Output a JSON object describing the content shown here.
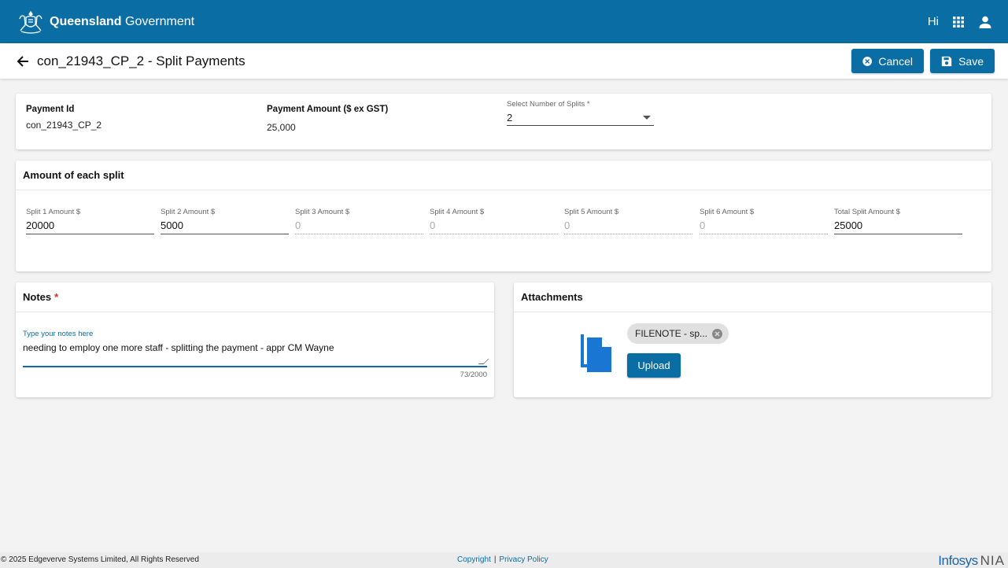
{
  "header": {
    "brand_bold": "Queensland",
    "brand_rest": " Government",
    "greeting": "Hi"
  },
  "subheader": {
    "title": "con_21943_CP_2 - Split Payments",
    "cancel_label": "Cancel",
    "save_label": "Save"
  },
  "payment": {
    "id_label": "Payment Id",
    "id_value": "con_21943_CP_2",
    "amount_label": "Payment Amount ($ ex GST)",
    "amount_value": "25,000",
    "splits_label": "Select Number of Splits *",
    "splits_value": "2"
  },
  "splits": {
    "title": "Amount of each split",
    "items": [
      {
        "label": "Split 1 Amount $",
        "value": "20000"
      },
      {
        "label": "Split 2 Amount $",
        "value": "5000"
      },
      {
        "label": "Split 3 Amount $",
        "value": "0"
      },
      {
        "label": "Split 4 Amount $",
        "value": "0"
      },
      {
        "label": "Split 5 Amount $",
        "value": "0"
      },
      {
        "label": "Split 6 Amount $",
        "value": "0"
      },
      {
        "label": "Total Split Amount $",
        "value": "25000"
      }
    ]
  },
  "notes": {
    "title": "Notes",
    "required_mark": "*",
    "placeholder": "Type your notes here",
    "value": "needing to employ one more staff - splitting the payment - appr CM Wayne",
    "counter": "73/2000"
  },
  "attachments": {
    "title": "Attachments",
    "file_chip": "FILENOTE - sp...",
    "upload_label": "Upload"
  },
  "footer": {
    "copyright": "© 2025 Edgeverve Systems Limited, All Rights Reserved",
    "copyright_link": "Copyright",
    "separator": "|",
    "privacy_link": "Privacy Policy",
    "logo_text": "Infosys",
    "logo_suffix": "NIA"
  },
  "colors": {
    "primary": "#0a6ea5",
    "required": "#d32f2f",
    "background": "#f3f3f3"
  }
}
